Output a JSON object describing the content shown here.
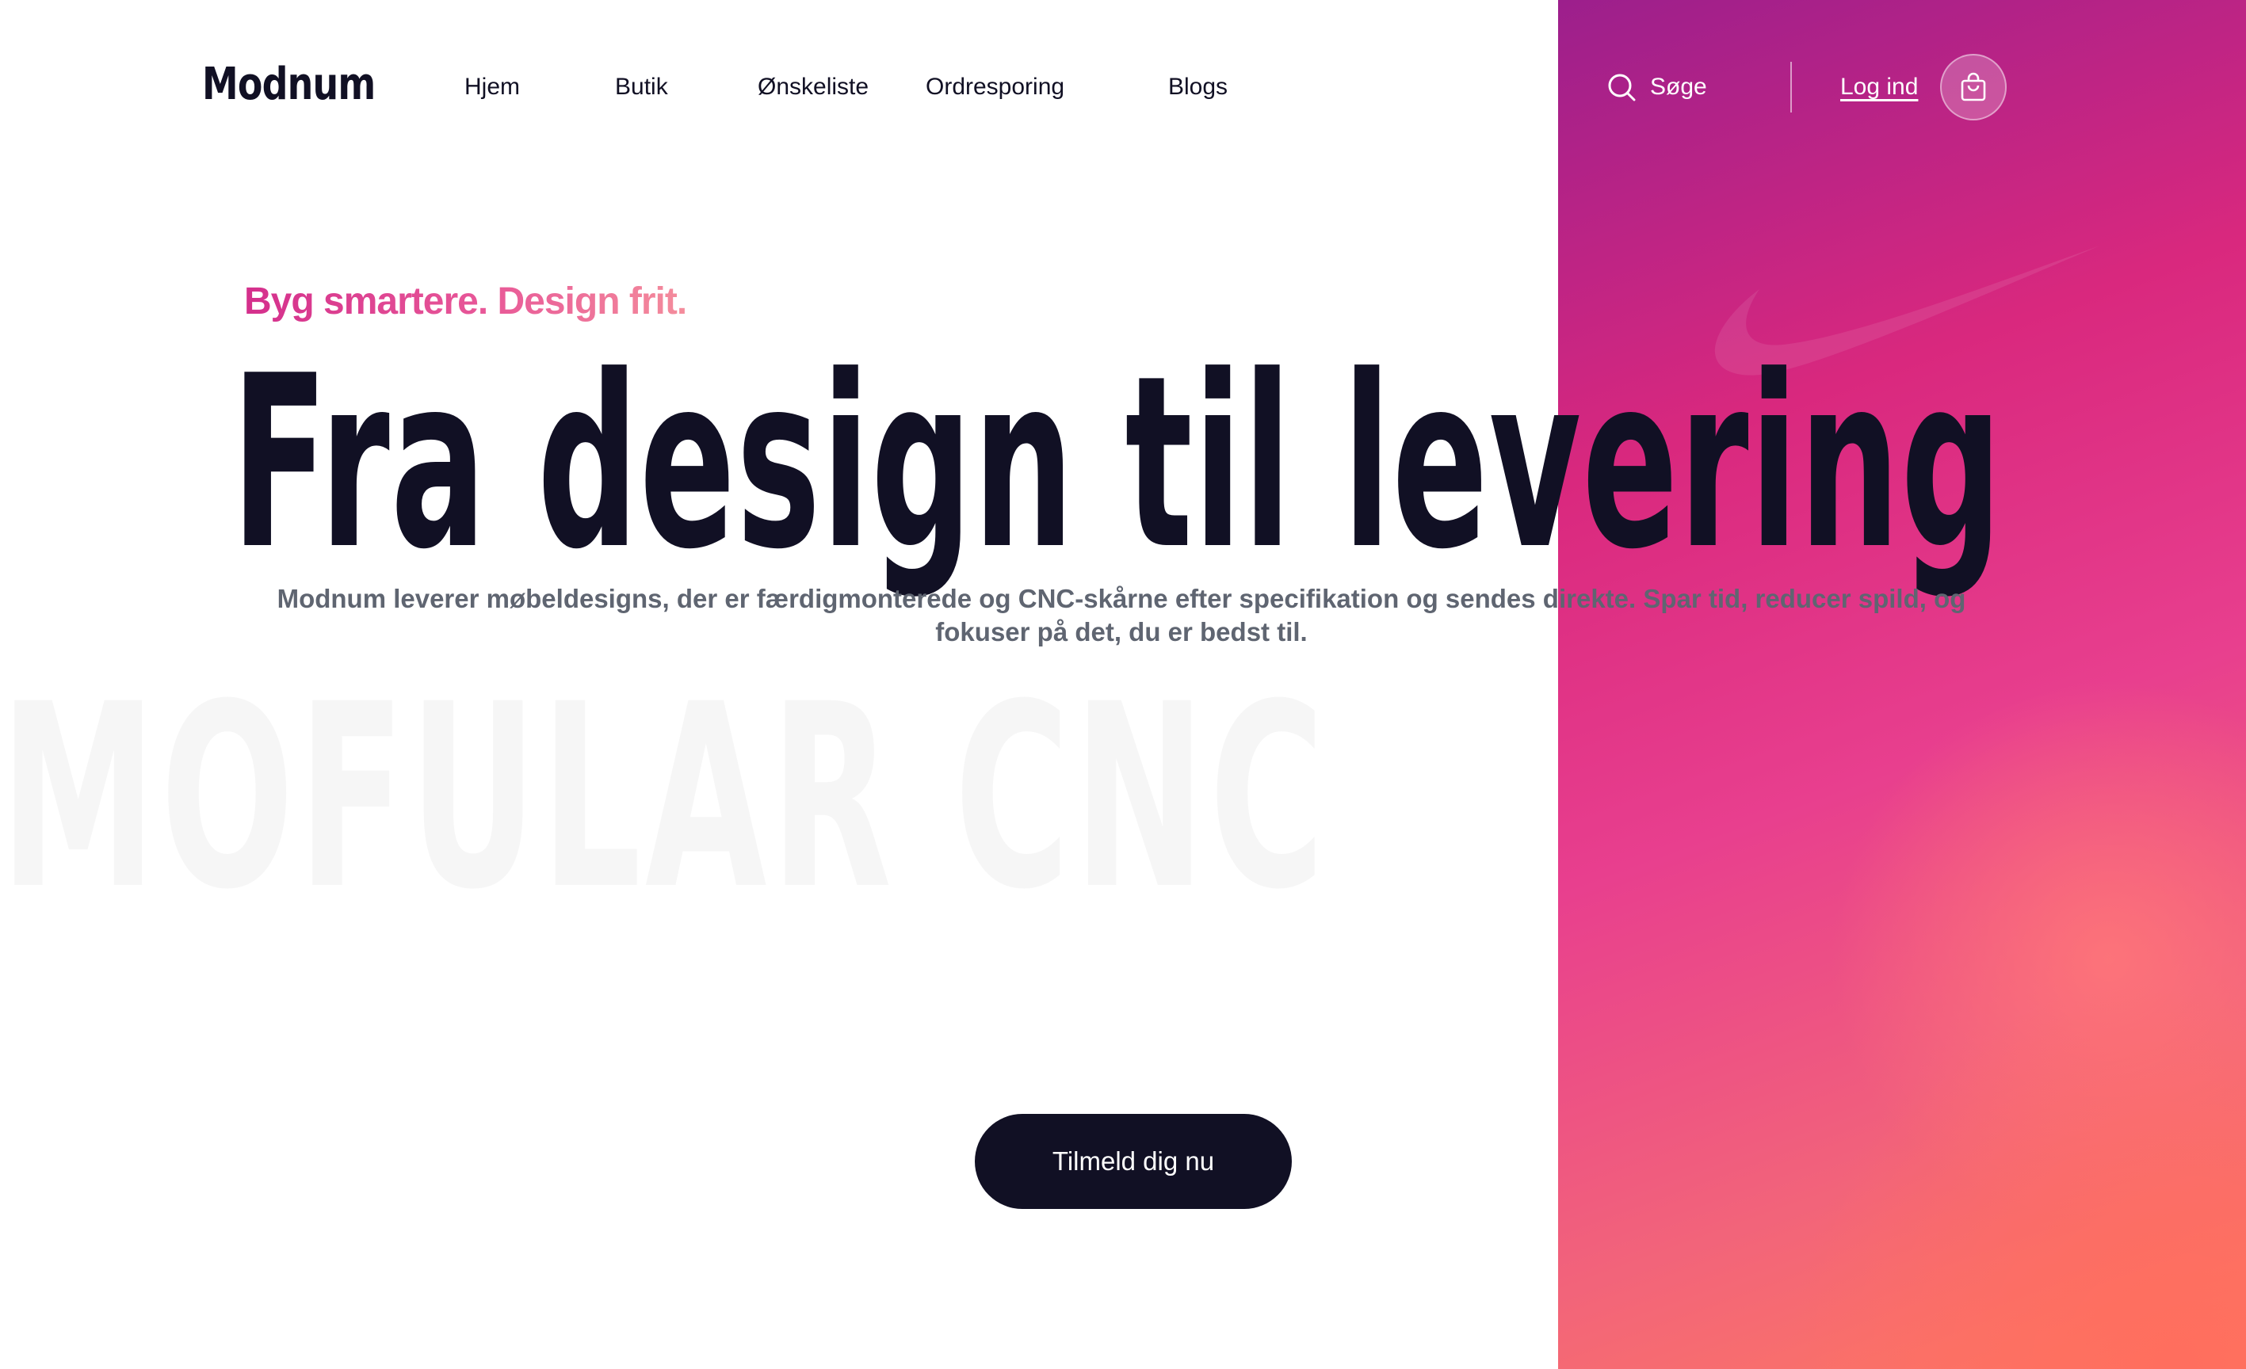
{
  "brand": {
    "logo_text": "Modnum"
  },
  "nav": {
    "items": [
      {
        "label": "Hjem"
      },
      {
        "label": "Butik"
      },
      {
        "label": "Ønskeliste"
      },
      {
        "label": "Ordresporing"
      },
      {
        "label": "Blogs"
      }
    ]
  },
  "header_actions": {
    "search_label": "Søge",
    "login_label": "Log ind",
    "cart_icon": "shopping-bag-icon",
    "search_icon": "search-icon"
  },
  "hero": {
    "tagline": "Byg smartere. Design frit.",
    "headline": "Fra design til levering",
    "description": "Modnum leverer møbeldesigns, der er færdigmonterede og CNC-skårne efter specifikation og sendes direkte. Spar tid, reducer spild, og fokuser på det, du er bedst til.",
    "background_text": "MOFULAR CNC Furniture",
    "cta_label": "Tilmeld dig nu"
  },
  "colors": {
    "primary_dark": "#111024",
    "accent_pink": "#d9287e",
    "accent_coral": "#ff7a5f",
    "muted_text": "#5f6571"
  }
}
